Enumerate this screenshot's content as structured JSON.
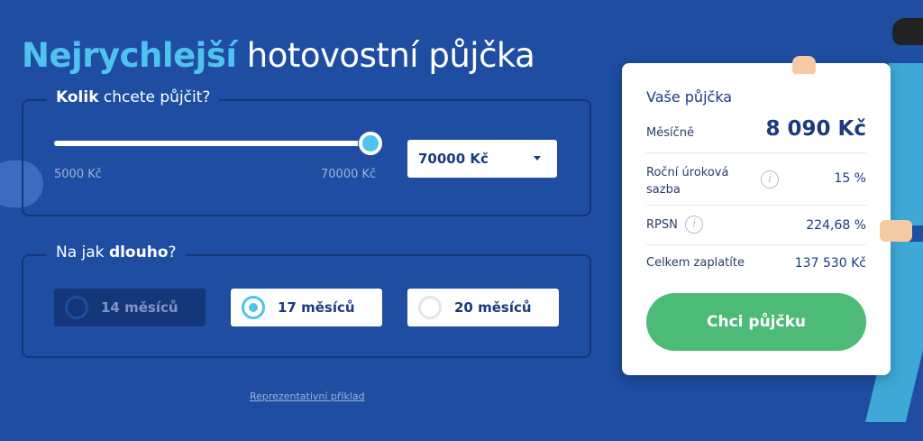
{
  "heading": {
    "accent": "Nejrychlejší",
    "rest": " hotovostní půjčka"
  },
  "amount_section": {
    "legend_bold": "Kolik",
    "legend_rest": " chcete půjčit?",
    "slider_min_label": "5000 Kč",
    "slider_max_label": "70000 Kč",
    "slider_level": 1.0,
    "select_value": "70000 Kč"
  },
  "duration_section": {
    "legend_start": "Na jak ",
    "legend_bold": "dlouho",
    "legend_end": "?",
    "options": [
      {
        "label": "14 měsíců",
        "state": "disabled"
      },
      {
        "label": "17 měsíců",
        "state": "selected"
      },
      {
        "label": "20 měsíců",
        "state": "unselected"
      }
    ]
  },
  "representative_link": "Reprezentativní příklad",
  "summary": {
    "title": "Vaše půjčka",
    "monthly_label": "Měsíčně",
    "monthly_value": "8 090 Kč",
    "rate_label_line1": "Roční úroková",
    "rate_label_line2": "sazba",
    "rate_value": "15 %",
    "rpsn_label": "RPSN",
    "rpsn_value": "224,68 %",
    "total_label": "Celkem zaplatíte",
    "total_value": "137 530 Kč",
    "cta_label": "Chci půjčku",
    "info_glyph": "i"
  },
  "colors": {
    "background": "#1e4da1",
    "accent": "#4fc3ef",
    "cta": "#4dba78",
    "text_dark": "#1a3b80"
  },
  "icons": [
    "info-icon",
    "chevron-down-icon",
    "radio-icon"
  ]
}
